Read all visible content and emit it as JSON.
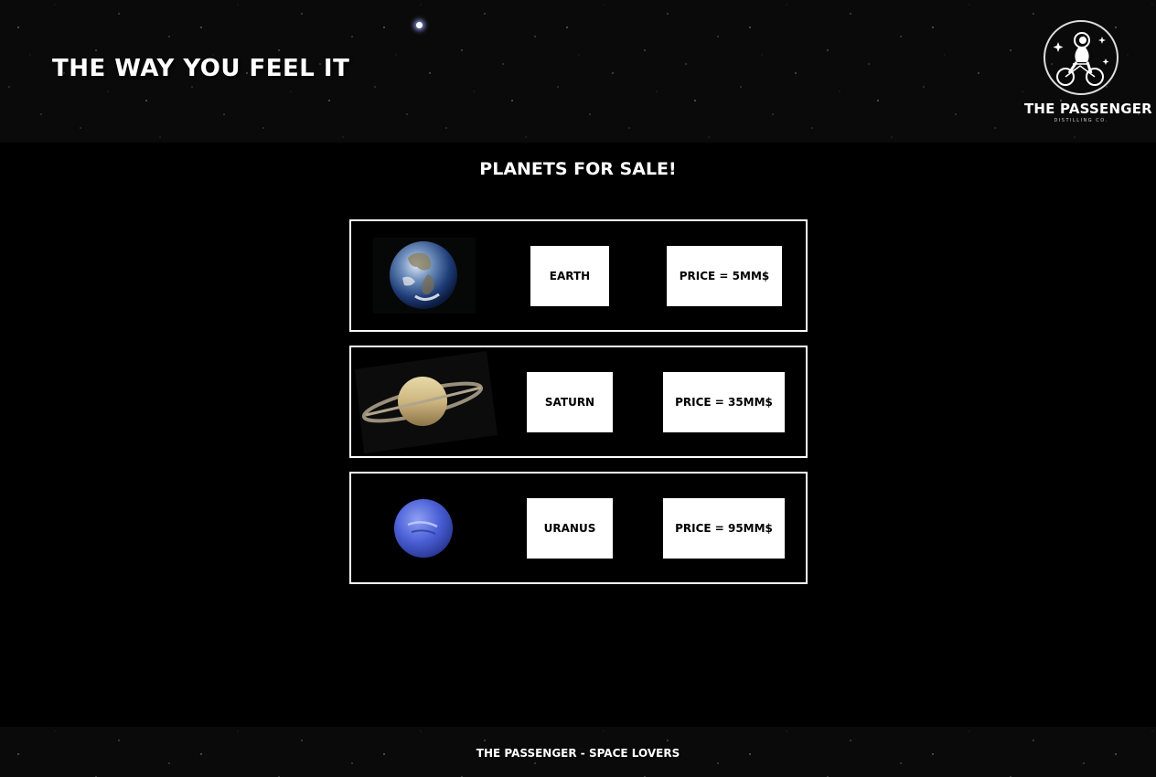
{
  "header": {
    "tagline": "THE WAY YOU FEEL IT",
    "logo_name": "THE PASSENGER",
    "logo_sub": "DISTILLING CO."
  },
  "main": {
    "title": "PLANETS FOR SALE!",
    "products": [
      {
        "name": "EARTH",
        "price": "PRICE = 5MM$",
        "icon": "earth-icon"
      },
      {
        "name": "SATURN",
        "price": "PRICE = 35MM$",
        "icon": "saturn-icon"
      },
      {
        "name": "URANUS",
        "price": "PRICE = 95MM$",
        "icon": "uranus-icon"
      }
    ]
  },
  "footer": {
    "text": "THE PASSENGER - SPACE LOVERS"
  },
  "colors": {
    "background": "#000000",
    "text": "#ffffff",
    "card_border": "#ffffff",
    "label_bg": "#ffffff",
    "label_text": "#000000"
  }
}
